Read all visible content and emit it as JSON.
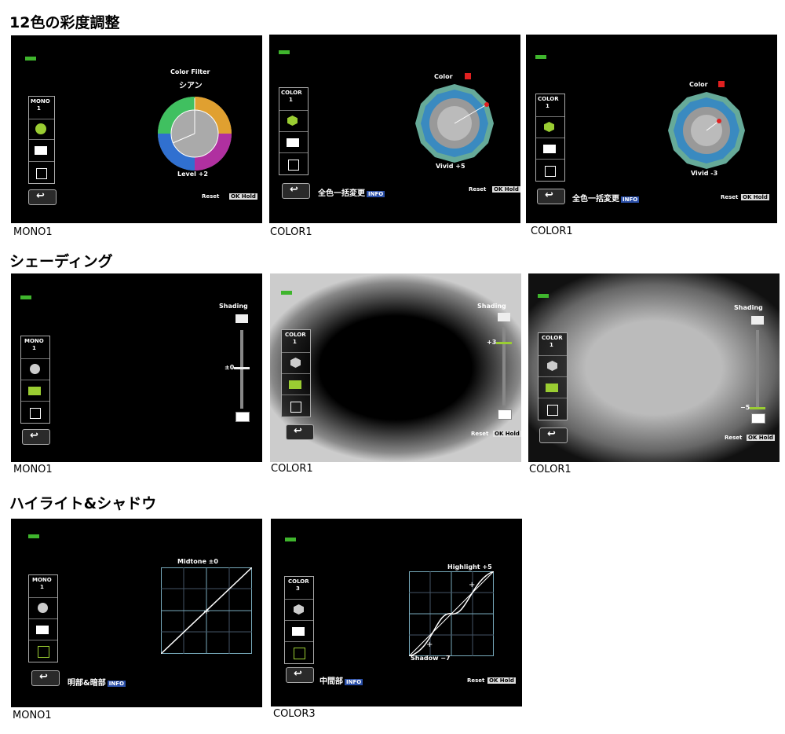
{
  "sections": [
    {
      "title": "12色の彩度調整"
    },
    {
      "title": "シェーディング"
    },
    {
      "title": "ハイライト&シャドウ"
    }
  ],
  "captions": {
    "s1a": "MONO1",
    "s1b": "COLOR1",
    "s1c": "COLOR1",
    "s2a": "MONO1",
    "s2b": "COLOR1",
    "s2c": "COLOR1",
    "s3a": "MONO1",
    "s3b": "COLOR3"
  },
  "screens": {
    "s1a": {
      "mode": "MONO",
      "num": "1",
      "top_label": "Color Filter",
      "top_value": "シアン",
      "bottom_label": "Level +2",
      "reset": "Reset",
      "ok": "OK Hold"
    },
    "s1b": {
      "mode": "COLOR",
      "num": "1",
      "top_label": "Color",
      "bottom_label": "Vivid +5",
      "action": "全色一括変更",
      "info": "INFO",
      "reset": "Reset",
      "ok": "OK Hold"
    },
    "s1c": {
      "mode": "COLOR",
      "num": "1",
      "top_label": "Color",
      "bottom_label": "Vivid -3",
      "action": "全色一括変更",
      "info": "INFO",
      "reset": "Reset",
      "ok": "OK Hold"
    },
    "s2a": {
      "mode": "MONO",
      "num": "1",
      "top_label": "Shading",
      "value": "±0"
    },
    "s2b": {
      "mode": "COLOR",
      "num": "1",
      "top_label": "Shading",
      "value": "+3",
      "reset": "Reset",
      "ok": "OK Hold"
    },
    "s2c": {
      "mode": "COLOR",
      "num": "1",
      "top_label": "Shading",
      "value": "−5",
      "reset": "Reset",
      "ok": "OK Hold"
    },
    "s3a": {
      "mode": "MONO",
      "num": "1",
      "top_label": "Midtone ±0",
      "action": "明部&暗部",
      "info": "INFO"
    },
    "s3b": {
      "mode": "COLOR",
      "num": "3",
      "top_label": "Highlight +5",
      "bottom_label": "Shadow −7",
      "action": "中間部",
      "info": "INFO",
      "reset": "Reset",
      "ok": "OK Hold"
    }
  },
  "colors": {
    "battery": "#3fb52d",
    "accent_green": "#9acd32",
    "accent_red": "#e02020"
  }
}
